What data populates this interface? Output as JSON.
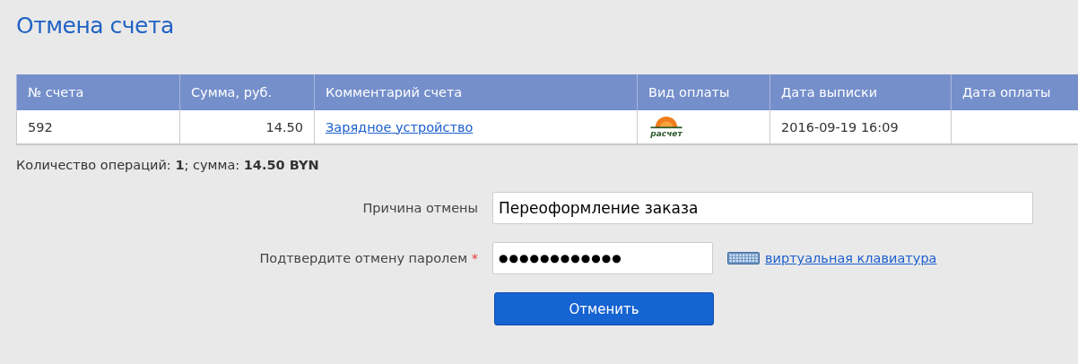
{
  "title": "Отмена счета",
  "table": {
    "columns": [
      "№ счета",
      "Сумма, руб.",
      "Комментарий счета",
      "Вид оплаты",
      "Дата выписки",
      "Дата оплаты"
    ],
    "rows": [
      {
        "number": "592",
        "amount": "14.50",
        "comment": "Зарядное устройство",
        "payment_logo": "расчет",
        "issued": "2016-09-19 16:09"
      }
    ]
  },
  "summary": "Количество операций: **1**; сумма: **14.50 BYN**",
  "form": {
    "reason": {
      "label": "Причина отмены",
      "value": "Переоформление заказа"
    },
    "password": {
      "label": "Подтвердите отмену паролем",
      "required_mark": "*",
      "value": "●●●●●●●●●●●●"
    },
    "keyboard_link": "виртуальная клавиатура",
    "submit": "Отменить"
  }
}
